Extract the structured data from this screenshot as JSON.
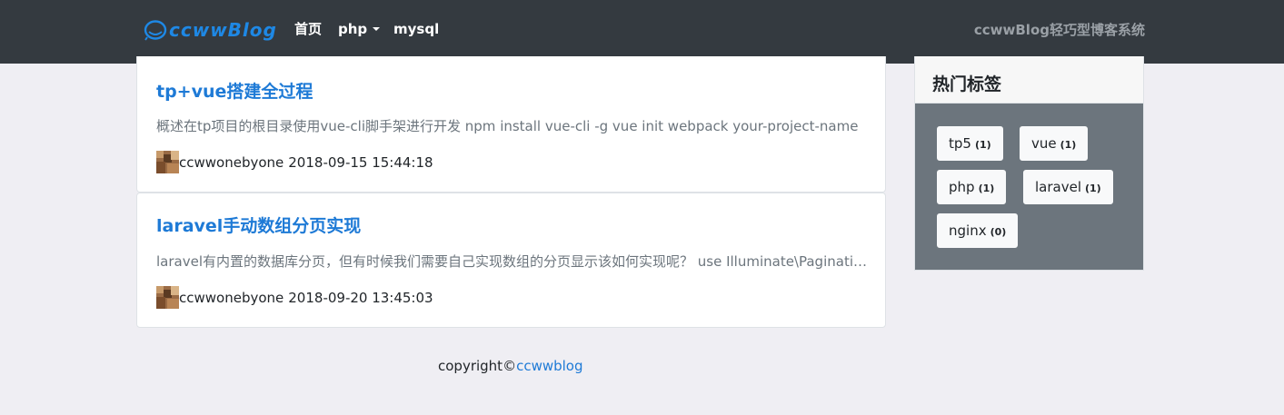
{
  "navbar": {
    "logo_text": "ccwwBlog",
    "links": [
      {
        "label": "首页"
      },
      {
        "label": "php"
      },
      {
        "label": "mysql"
      }
    ],
    "right_text": "ccwwBlog轻巧型博客系统"
  },
  "posts": [
    {
      "title": "tp+vue搭建全过程",
      "excerpt": "概述在tp项目的根目录使用vue-cli脚手架进行开发 npm install vue-cli -g vue init webpack your-project-name",
      "author": "ccwwonebyone",
      "date": "2018-09-15 15:44:18"
    },
    {
      "title": "laravel手动数组分页实现",
      "excerpt": "laravel有内置的数据库分页，但有时候我们需要自己实现数组的分页显示该如何实现呢？ use Illuminate\\Pagination",
      "author": "ccwwonebyone",
      "date": "2018-09-20 13:45:03"
    }
  ],
  "sidebar": {
    "title": "热门标签",
    "tags": [
      {
        "name": "tp5",
        "count": "(1)"
      },
      {
        "name": "vue",
        "count": "(1)"
      },
      {
        "name": "php",
        "count": "(1)"
      },
      {
        "name": "laravel",
        "count": "(1)"
      },
      {
        "name": "nginx",
        "count": "(0)"
      }
    ]
  },
  "footer": {
    "prefix": "copyright©",
    "link": "ccwwblog"
  },
  "colors": {
    "navbar_bg": "#343a40",
    "link_blue": "#1e7ad6",
    "sidebar_body": "#6c757d",
    "page_bg": "#efeef3"
  }
}
